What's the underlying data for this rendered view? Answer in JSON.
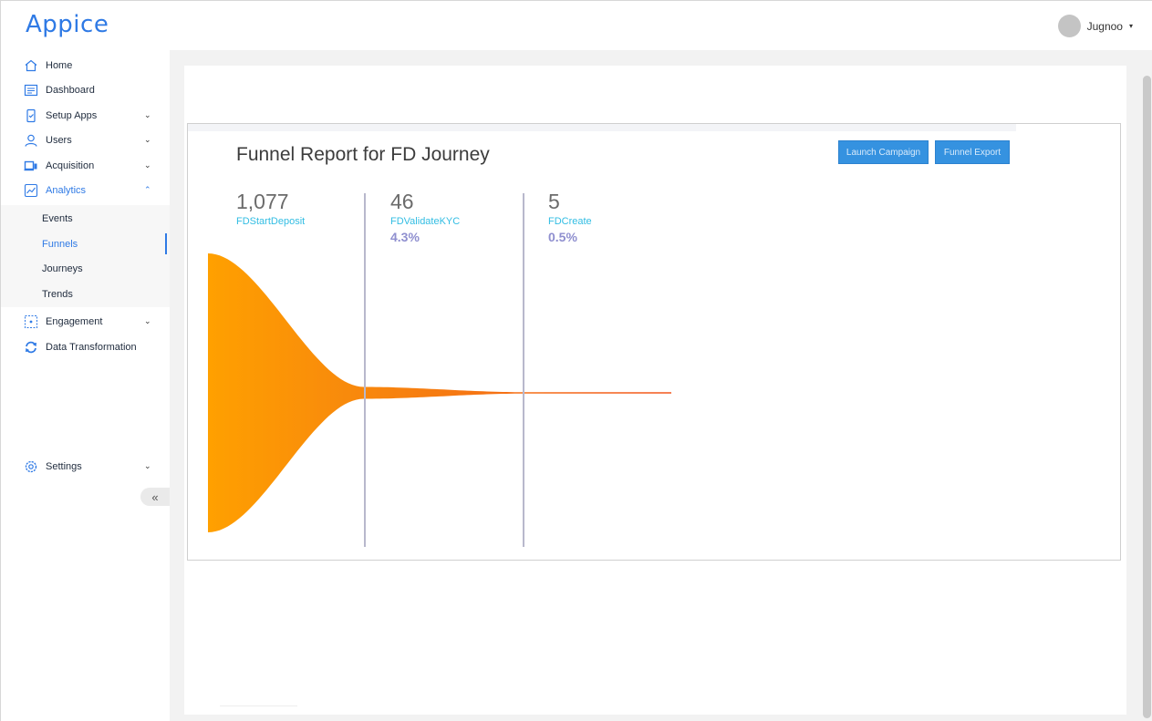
{
  "app": {
    "logo": "Appice"
  },
  "header": {
    "user_name": "Jugnoo",
    "user_caret": "▾"
  },
  "sidebar": {
    "items": [
      {
        "label": "Home",
        "icon": "home-icon"
      },
      {
        "label": "Dashboard",
        "icon": "dashboard-icon"
      },
      {
        "label": "Setup Apps",
        "icon": "setup-apps-icon",
        "chevron": "⌄"
      },
      {
        "label": "Users",
        "icon": "user-icon",
        "chevron": "⌄"
      },
      {
        "label": "Acquisition",
        "icon": "acquisition-icon",
        "chevron": "⌄"
      },
      {
        "label": "Analytics",
        "icon": "analytics-icon",
        "chevron": "⌃"
      },
      {
        "label": "Engagement",
        "icon": "engagement-icon",
        "chevron": "⌄"
      },
      {
        "label": "Data Transformation",
        "icon": "sync-icon"
      },
      {
        "label": "Settings",
        "icon": "gear-icon",
        "chevron": "⌄"
      }
    ],
    "analytics_submenu": [
      "Events",
      "Funnels",
      "Journeys",
      "Trends"
    ],
    "collapse_label": "«"
  },
  "report": {
    "title": "Funnel Report for FD Journey",
    "launch_button": "Launch Campaign",
    "export_button": "Funnel Export"
  },
  "colors": {
    "accent": "#2f7ae5",
    "funnel_start": "#ffa000",
    "funnel_end": "#f2561d",
    "step_name": "#32bde3",
    "percent": "#8f8fcf"
  },
  "chart_data": {
    "type": "funnel",
    "steps": [
      {
        "name": "FDStartDeposit",
        "count": "1,077",
        "value": 1077,
        "percent": ""
      },
      {
        "name": "FDValidateKYC",
        "count": "46",
        "value": 46,
        "percent": "4.3%"
      },
      {
        "name": "FDCreate",
        "count": "5",
        "value": 5,
        "percent": "0.5%"
      }
    ]
  }
}
